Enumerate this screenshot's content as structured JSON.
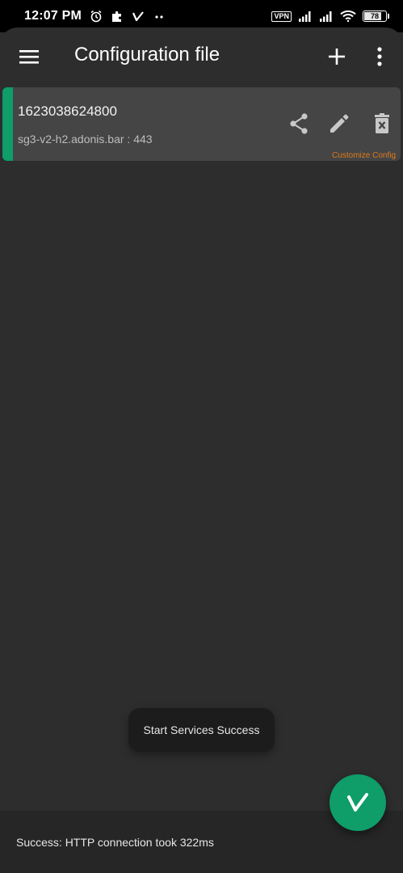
{
  "status_bar": {
    "time": "12:07 PM",
    "left_icons": [
      "alarm-icon",
      "puzzle-icon",
      "v2ray-icon",
      "more-dots-icon"
    ],
    "vpn_label": "VPN",
    "battery_level": "78",
    "right_icons": [
      "signal-icon",
      "signal-icon",
      "wifi-icon",
      "battery-icon"
    ]
  },
  "app_bar": {
    "title": "Configuration file",
    "menu_icon": "hamburger-menu-icon",
    "add_icon": "plus-icon",
    "more_icon": "vertical-dots-icon"
  },
  "config_list": [
    {
      "remarks": "1623038624800",
      "address": "sg3-v2-h2.adonis.bar : 443",
      "type_label": "Customize Config",
      "selected": true,
      "accent_color": "#0f9d6a",
      "actions": [
        "share-icon",
        "edit-icon",
        "delete-icon"
      ]
    }
  ],
  "toast": {
    "message": "Start Services Success"
  },
  "bottom_status": {
    "text": "Success: HTTP connection took 322ms"
  },
  "fab": {
    "icon": "v-logo-icon",
    "color": "#0f9d6a",
    "state": "connected"
  },
  "colors": {
    "background": "#2d2d2d",
    "card": "#454545",
    "accent": "#0f9d6a",
    "type_label": "#e07b1a"
  }
}
